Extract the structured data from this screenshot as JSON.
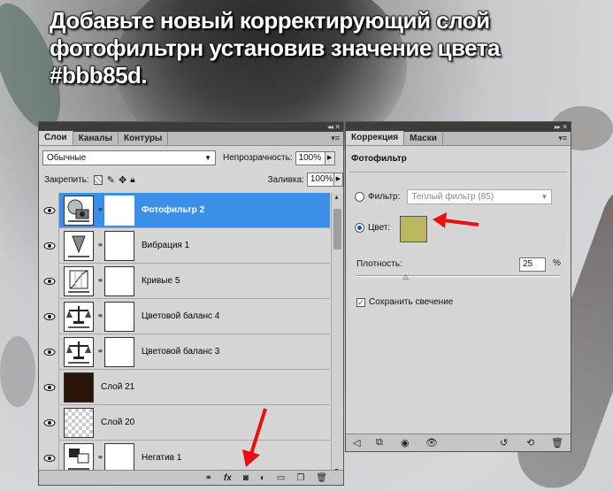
{
  "headline": {
    "line1": "Добавьте новый корректирующий слой",
    "line2": "фотофильтрн установив значение цвета",
    "line3": "#bbb85d."
  },
  "layers_panel": {
    "tabs": [
      "Слои",
      "Каналы",
      "Контуры"
    ],
    "blend_mode": "Обычные",
    "opacity_label": "Непрозрачность:",
    "opacity_value": "100%",
    "lock_label": "Закрепить:",
    "fill_label": "Заливка:",
    "fill_value": "100%",
    "layers": [
      {
        "name": "Фотофильтр 2",
        "thumb": "photo-filter-icon",
        "has_mask": true,
        "selected": true
      },
      {
        "name": "Вибрация 1",
        "thumb": "vibrance-icon",
        "has_mask": true,
        "selected": false
      },
      {
        "name": "Кривые 5",
        "thumb": "curves-icon",
        "has_mask": true,
        "selected": false
      },
      {
        "name": "Цветовой баланс 4",
        "thumb": "color-balance-icon",
        "has_mask": true,
        "selected": false
      },
      {
        "name": "Цветовой баланс 3",
        "thumb": "color-balance-icon",
        "has_mask": true,
        "selected": false
      },
      {
        "name": "Слой 21",
        "thumb": "dark-brown-fill",
        "has_mask": false,
        "selected": false
      },
      {
        "name": "Слой 20",
        "thumb": "transparent-checker",
        "has_mask": false,
        "selected": false
      },
      {
        "name": "Негатив 1",
        "thumb": "invert-icon",
        "has_mask": true,
        "selected": false
      }
    ],
    "bottom_icons": [
      "link-icon",
      "fx-icon",
      "mask-icon",
      "adjustment-icon",
      "group-icon",
      "new-layer-icon",
      "trash-icon"
    ],
    "fx_label": "fx"
  },
  "correction_panel": {
    "tabs": [
      "Коррекция",
      "Маски"
    ],
    "title": "Фотофильтр",
    "filter_label": "Фильтр:",
    "filter_value": "Теплый фильтр (85)",
    "color_label": "Цвет:",
    "color_value": "#bbb85d",
    "density_label": "Плотность:",
    "density_value": "25",
    "density_unit": "%",
    "density_fraction": 0.25,
    "preserve_label": "Сохранить свечение",
    "preserve_checked": true
  },
  "colors": {
    "selection_blue": "#3b8fe8",
    "swatch": "#bbb85d",
    "annotation_red": "#e81010",
    "panel_bg": "#d6d6d6"
  }
}
